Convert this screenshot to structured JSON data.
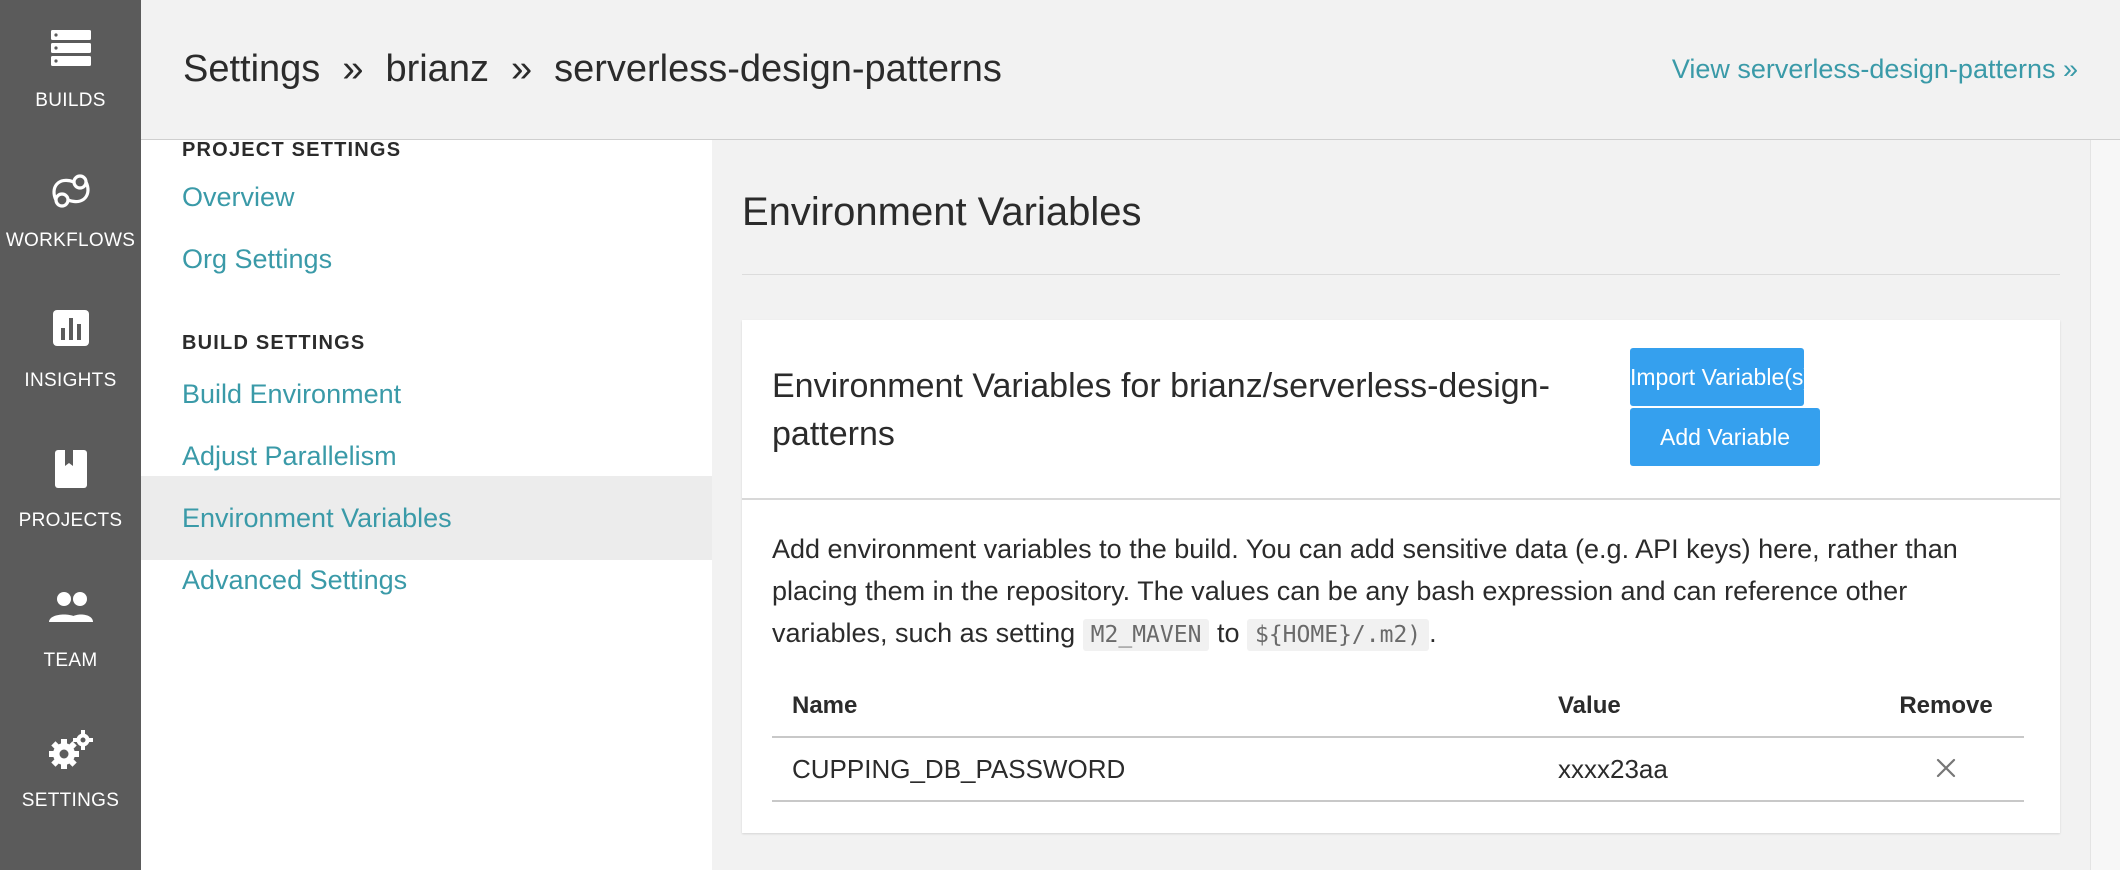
{
  "rail": {
    "items": [
      {
        "label": "BUILDS",
        "icon": "builds-icon"
      },
      {
        "label": "WORKFLOWS",
        "icon": "workflows-icon"
      },
      {
        "label": "INSIGHTS",
        "icon": "insights-icon"
      },
      {
        "label": "PROJECTS",
        "icon": "projects-icon"
      },
      {
        "label": "TEAM",
        "icon": "team-icon"
      },
      {
        "label": "SETTINGS",
        "icon": "settings-icon"
      }
    ]
  },
  "header": {
    "crumb_settings": "Settings",
    "crumb_sep": "»",
    "crumb_org": "brianz",
    "crumb_project": "serverless-design-patterns",
    "view_link": "View serverless-design-patterns »"
  },
  "sidenav": {
    "project_settings_title": "PROJECT SETTINGS",
    "overview": "Overview",
    "org_settings": "Org Settings",
    "build_settings_title": "BUILD SETTINGS",
    "build_environment": "Build Environment",
    "adjust_parallelism": "Adjust Parallelism",
    "environment_variables": "Environment Variables",
    "advanced_settings": "Advanced Settings"
  },
  "main": {
    "page_title": "Environment Variables",
    "card": {
      "title": "Environment Variables for brianz/serverless-design-patterns",
      "import_button": "Import Variable(s)",
      "add_button": "Add Variable",
      "desc_part1": "Add environment variables to the build. You can add sensitive data (e.g. API keys) here, rather than placing them in the repository. The values can be any bash expression and can reference other variables, such as setting ",
      "desc_code1": "M2_MAVEN",
      "desc_part2": " to ",
      "desc_code2": "${HOME}/.m2)",
      "desc_part3": "."
    },
    "table": {
      "headers": {
        "name": "Name",
        "value": "Value",
        "remove": "Remove"
      },
      "rows": [
        {
          "name": "CUPPING_DB_PASSWORD",
          "value": "xxxx23aa"
        }
      ]
    }
  },
  "colors": {
    "rail_bg": "#5b5b5b",
    "link": "#3a9aa8",
    "button": "#35a0ee",
    "header_bg": "#f2f2f2"
  }
}
